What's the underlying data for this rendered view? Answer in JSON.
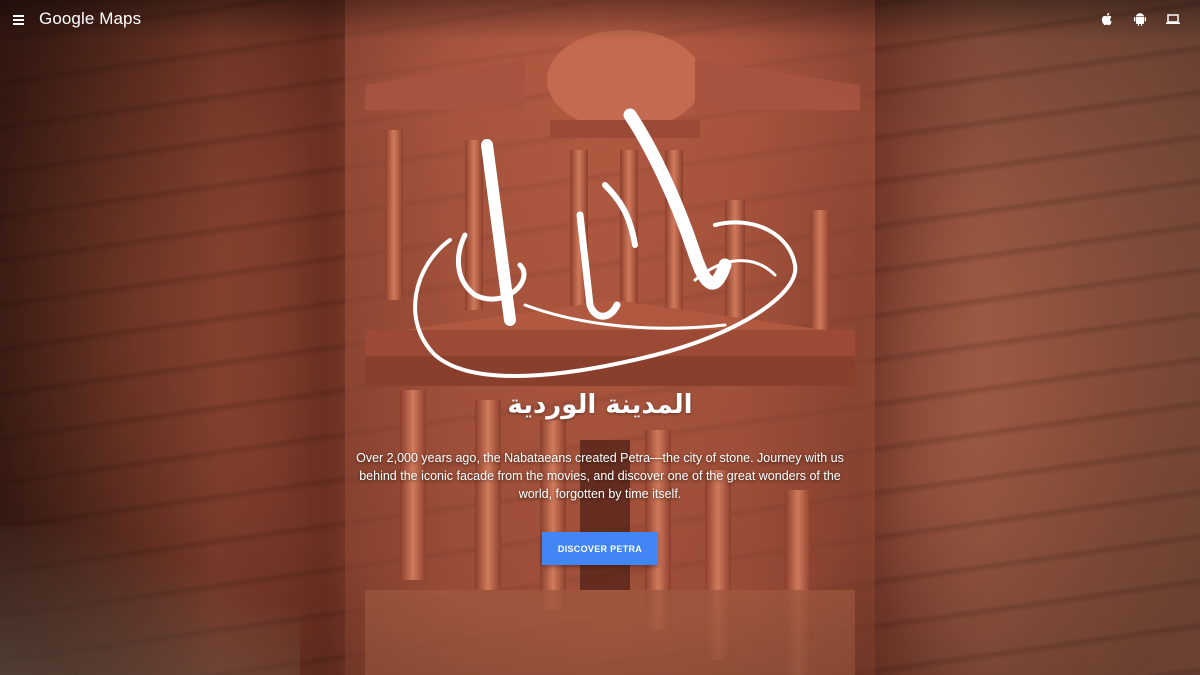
{
  "header": {
    "brand": "Google Maps",
    "platforms": [
      {
        "icon": "apple-icon"
      },
      {
        "icon": "android-icon"
      },
      {
        "icon": "laptop-icon"
      }
    ]
  },
  "hero": {
    "arabic_subtitle": "المدينة الوردية",
    "description": "Over 2,000 years ago, the Nabataeans created Petra—the city of stone. Journey with us behind the iconic facade from the movies, and discover one of the great wonders of the world, forgotten by time itself.",
    "cta_label": "DISCOVER PETRA",
    "cta_color": "#4285f4"
  }
}
